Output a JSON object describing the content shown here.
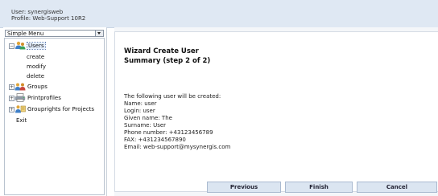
{
  "header": {
    "user_text": "User: synergisweb",
    "profile_text": "Profile: Web-Support 10R2"
  },
  "sidebar": {
    "menu_select": "Simple Menu",
    "tree": [
      {
        "label": "Users",
        "expander": "−",
        "icon": "users-icon",
        "expanded": true,
        "children": [
          "create",
          "modify",
          "delete"
        ]
      },
      {
        "label": "Groups",
        "expander": "+",
        "icon": "groups-icon"
      },
      {
        "label": "Printprofiles",
        "expander": "+",
        "icon": "printprofiles-icon"
      },
      {
        "label": "Grouprights for Projects",
        "expander": "+",
        "icon": "grouprights-icon"
      }
    ],
    "exit_label": "Exit"
  },
  "wizard": {
    "title": "Wizard Create User",
    "subtitle": "Summary (step 2 of 2)",
    "summary_lines": [
      "The following user will be created:",
      "Name: user",
      "Login: user",
      "Given name: The",
      "Surname: User",
      "Phone number: +43123456789",
      "FAX: +431234567890",
      "Email: web-support@mysynergis.com"
    ],
    "buttons": {
      "previous": "Previous",
      "finish": "Finish",
      "cancel": "Cancel"
    }
  },
  "colors": {
    "header_bg": "#dfe8f3",
    "button_bg": "#dbe5f1",
    "content_bg": "#f4f6f9"
  }
}
